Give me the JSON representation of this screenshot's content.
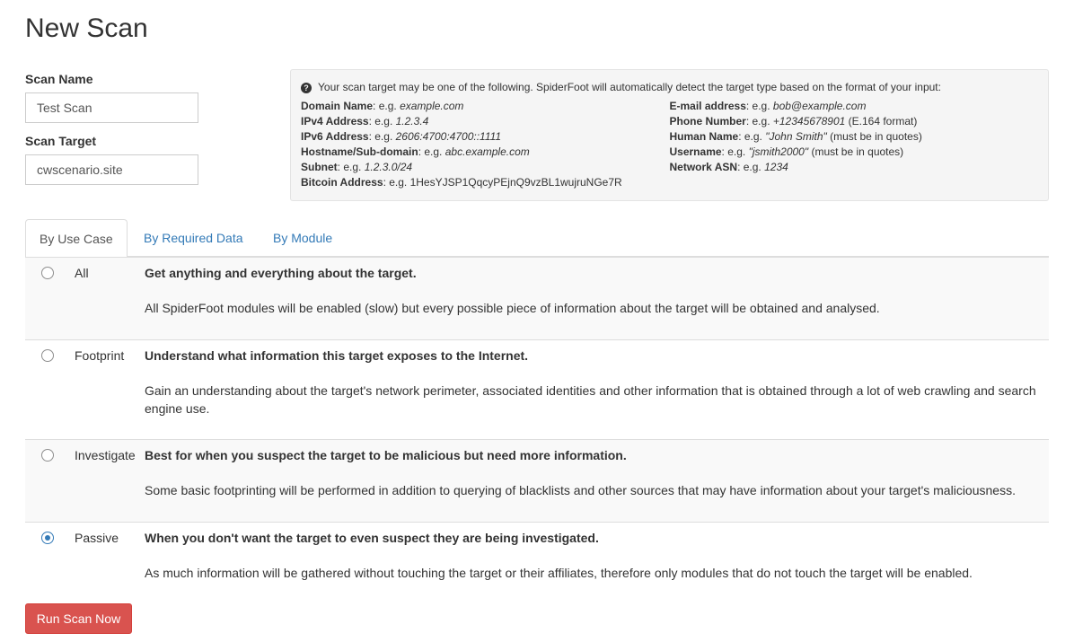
{
  "page": {
    "title": "New Scan"
  },
  "form": {
    "scan_name_label": "Scan Name",
    "scan_name_value": "Test Scan",
    "scan_target_label": "Scan Target",
    "scan_target_value": "cwscenario.site"
  },
  "info": {
    "intro": "Your scan target may be one of the following. SpiderFoot will automatically detect the target type based on the format of your input:",
    "left": [
      {
        "label": "Domain Name",
        "sep": ": e.g. ",
        "example": "example.com",
        "note": ""
      },
      {
        "label": "IPv4 Address",
        "sep": ": e.g. ",
        "example": "1.2.3.4",
        "note": ""
      },
      {
        "label": "IPv6 Address",
        "sep": ": e.g. ",
        "example": "2606:4700:4700::1111",
        "note": ""
      },
      {
        "label": "Hostname/Sub-domain",
        "sep": ": e.g. ",
        "example": "abc.example.com",
        "note": ""
      },
      {
        "label": "Subnet",
        "sep": ": e.g. ",
        "example": "1.2.3.0/24",
        "note": ""
      },
      {
        "label": "Bitcoin Address",
        "sep": ": e.g. 1HesYJSP1QqcyPEjnQ9vzBL1wujruNGe7R",
        "example": "",
        "note": ""
      }
    ],
    "right": [
      {
        "label": "E-mail address",
        "sep": ": e.g. ",
        "example": "bob@example.com",
        "note": ""
      },
      {
        "label": "Phone Number",
        "sep": ": e.g. ",
        "example": "+12345678901",
        "note": " (E.164 format)"
      },
      {
        "label": "Human Name",
        "sep": ": e.g. ",
        "example": "\"John Smith\"",
        "note": " (must be in quotes)"
      },
      {
        "label": "Username",
        "sep": ": e.g. ",
        "example": "\"jsmith2000\"",
        "note": " (must be in quotes)"
      },
      {
        "label": "Network ASN",
        "sep": ": e.g. ",
        "example": "1234",
        "note": ""
      }
    ]
  },
  "tabs": [
    {
      "label": "By Use Case"
    },
    {
      "label": "By Required Data"
    },
    {
      "label": "By Module"
    }
  ],
  "usecases": [
    {
      "name": "All",
      "title": "Get anything and everything about the target.",
      "desc": "All SpiderFoot modules will be enabled (slow) but every possible piece of information about the target will be obtained and analysed.",
      "selected": false
    },
    {
      "name": "Footprint",
      "title": "Understand what information this target exposes to the Internet.",
      "desc": "Gain an understanding about the target's network perimeter, associated identities and other information that is obtained through a lot of web crawling and search engine use.",
      "selected": false
    },
    {
      "name": "Investigate",
      "title": "Best for when you suspect the target to be malicious but need more information.",
      "desc": "Some basic footprinting will be performed in addition to querying of blacklists and other sources that may have information about your target's maliciousness.",
      "selected": false
    },
    {
      "name": "Passive",
      "title": "When you don't want the target to even suspect they are being investigated.",
      "desc": "As much information will be gathered without touching the target or their affiliates, therefore only modules that do not touch the target will be enabled.",
      "selected": true
    }
  ],
  "actions": {
    "run_label": "Run Scan Now"
  },
  "colors": {
    "accent": "#337ab7",
    "danger": "#d9534f"
  }
}
